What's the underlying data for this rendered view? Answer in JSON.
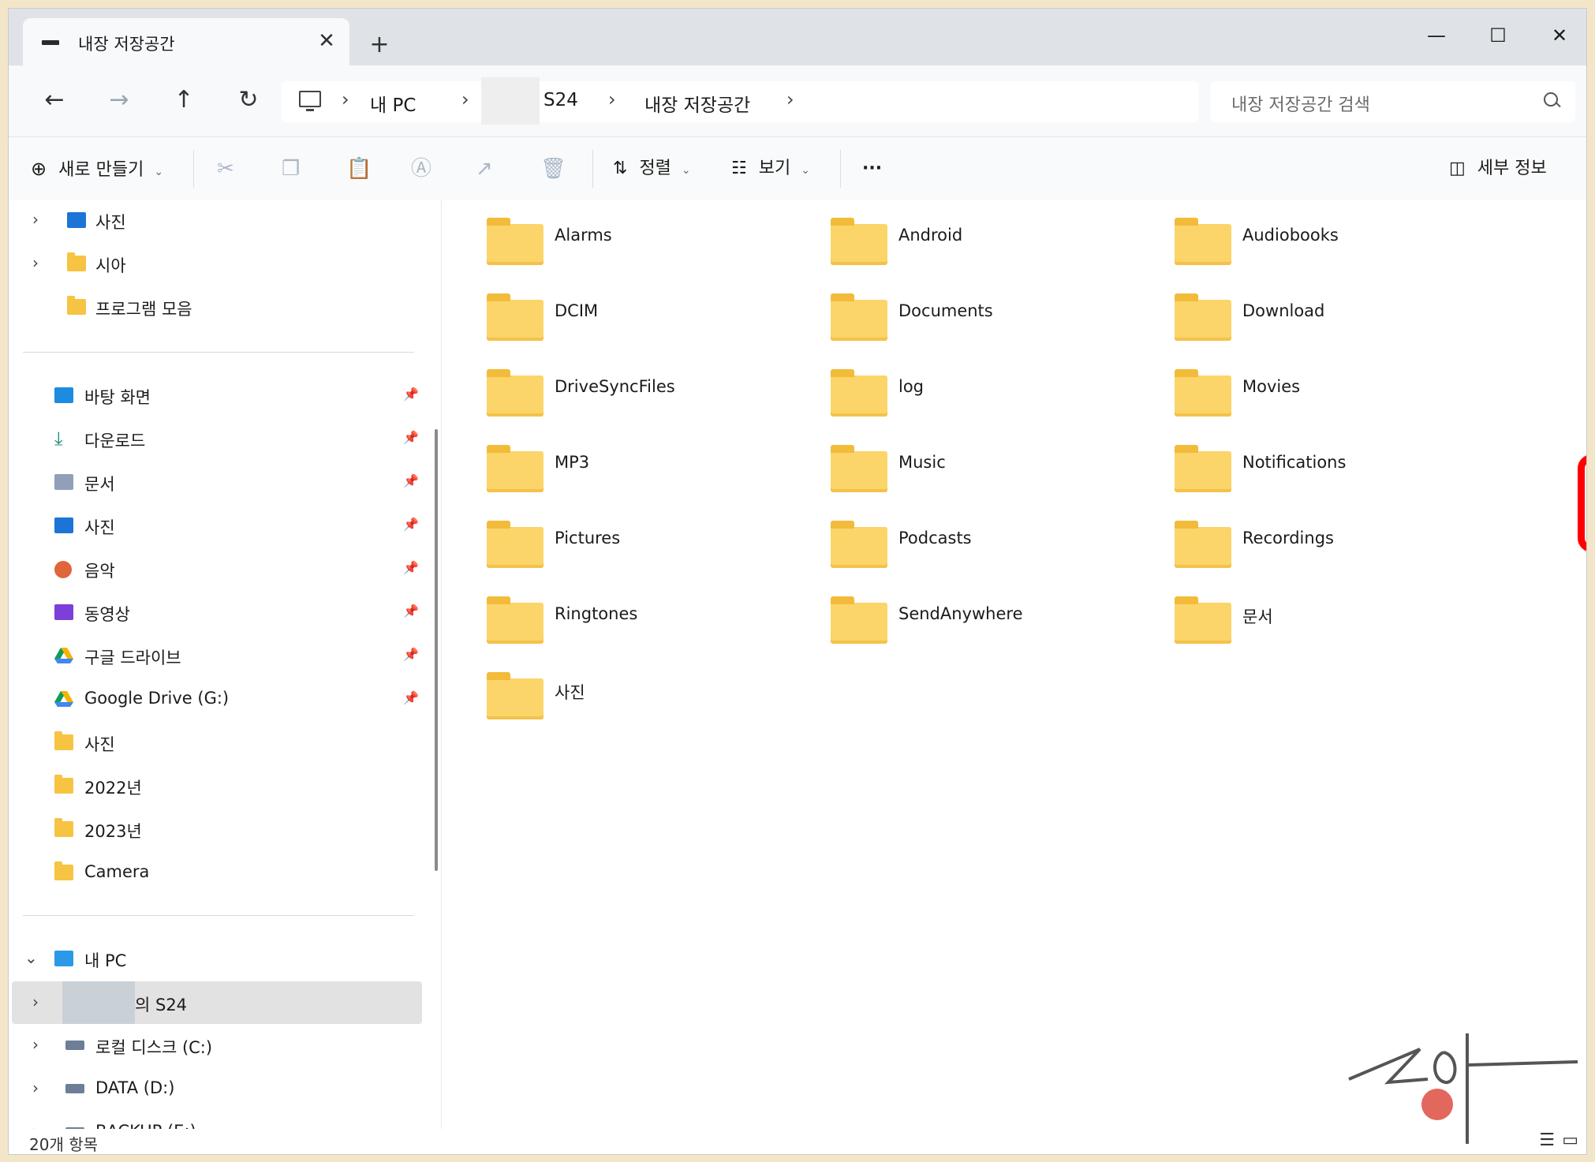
{
  "window": {
    "tab_title": "내장 저장공간",
    "tab_close": "✕",
    "new_tab": "+",
    "minimize": "—",
    "maximize": "☐",
    "close": "✕"
  },
  "nav": {
    "back": "←",
    "forward": "→",
    "up": "↑",
    "refresh": "↻"
  },
  "breadcrumb": {
    "items": [
      "내 PC",
      "S24",
      "내장 저장공간"
    ],
    "separator": "›"
  },
  "search": {
    "placeholder": "내장 저장공간 검색"
  },
  "toolbar": {
    "new_label": "새로 만들기",
    "sort_label": "정렬",
    "view_label": "보기",
    "more_label": "···",
    "details_label": "세부 정보"
  },
  "sidebar": {
    "top_items": [
      {
        "label": "사진",
        "icon": "pictures-icon"
      },
      {
        "label": "시아",
        "icon": "folder-icon"
      },
      {
        "label": "프로그램 모음",
        "icon": "folder-icon"
      }
    ],
    "quick_access": [
      {
        "label": "바탕 화면",
        "icon": "desktop-icon",
        "pinned": true
      },
      {
        "label": "다운로드",
        "icon": "download-icon",
        "pinned": true
      },
      {
        "label": "문서",
        "icon": "documents-icon",
        "pinned": true
      },
      {
        "label": "사진",
        "icon": "pictures-icon",
        "pinned": true
      },
      {
        "label": "음악",
        "icon": "music-icon",
        "pinned": true
      },
      {
        "label": "동영상",
        "icon": "videos-icon",
        "pinned": true
      },
      {
        "label": "구글 드라이브",
        "icon": "google-drive-icon",
        "pinned": true
      },
      {
        "label": "Google Drive (G:)",
        "icon": "google-drive-icon",
        "pinned": true
      },
      {
        "label": "사진",
        "icon": "folder-icon",
        "pinned": false
      },
      {
        "label": "2022년",
        "icon": "folder-icon",
        "pinned": false
      },
      {
        "label": "2023년",
        "icon": "folder-icon",
        "pinned": false
      },
      {
        "label": "Camera",
        "icon": "folder-icon",
        "pinned": false
      }
    ],
    "this_pc": {
      "label": "내 PC",
      "icon": "monitor-icon"
    },
    "devices": [
      {
        "label": "의 S24",
        "icon": "phone-icon"
      },
      {
        "label": "로컬 디스크 (C:)",
        "icon": "disk-icon"
      },
      {
        "label": "DATA (D:)",
        "icon": "disk-icon"
      },
      {
        "label": "BACKUP (E:)",
        "icon": "disk-icon"
      }
    ]
  },
  "folders": [
    "Alarms",
    "Android",
    "Audiobooks",
    "DCIM",
    "Documents",
    "Download",
    "DriveSyncFiles",
    "log",
    "Movies",
    "MP3",
    "Music",
    "Notifications",
    "Pictures",
    "Podcasts",
    "Recordings",
    "Ringtones",
    "SendAnywhere",
    "문서",
    "사진"
  ],
  "highlighted_folder": "Download",
  "highlight_color": "#ff0000",
  "status": {
    "item_count": "20개 항목"
  }
}
